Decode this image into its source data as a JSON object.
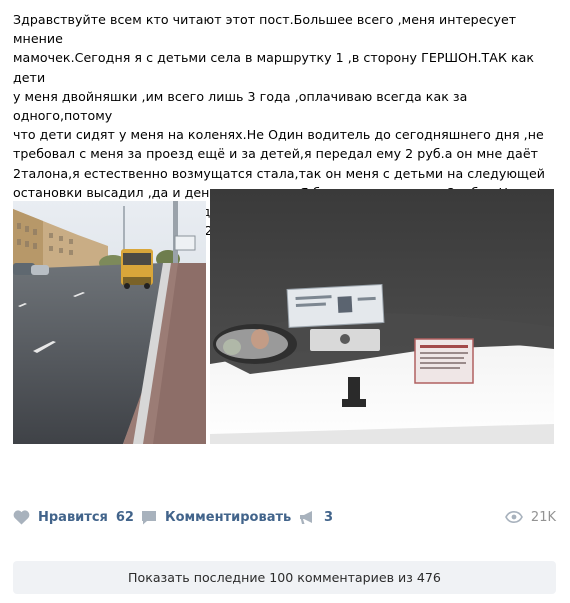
{
  "post": {
    "text": "Здравствуйте всем кто читают этот пост.Большее всего ,меня интересует мнение\nмамочек.Сегодня я с детьми села в маршрутку 1 ,в сторону ГЕРШОН.ТАК как дети\nу меня двойняшки ,им всего лишь 3 года ,оплачиваю всегда как за одного,потому\nчто дети сидят у меня на коленях.Не Один водитель до сегодняшнего дня ,не\nтребовал с меня за проезд ещё и за детей,я передал ему 2 руб.а он мне даёт\n2талона,я естественно возмущатся стала,так он меня с детьми на следующей\nостановки высадил ,да и деньги не отдал.Я беднее не стала на 2рубля.Но так\nделать нельзя.Пусть ему будет стыдно вот его номер машины на котором он\nработает.Гос номер1ТАХ- 0521"
  },
  "actions": {
    "like_label": "Нравится",
    "like_count": "62",
    "comment_label": "Комментировать",
    "share_count": "3",
    "views_count": "21K"
  },
  "comments": {
    "show_more_label": "Показать последние 100 комментариев из 476"
  },
  "icons": {
    "like": "heart-icon",
    "comment": "speech-bubble-icon",
    "share": "megaphone-icon",
    "views": "eye-icon"
  },
  "colors": {
    "action_text": "#42648b",
    "icon_gray": "#a8b2bd",
    "views_gray": "#939393",
    "button_bg": "#f0f2f5"
  }
}
